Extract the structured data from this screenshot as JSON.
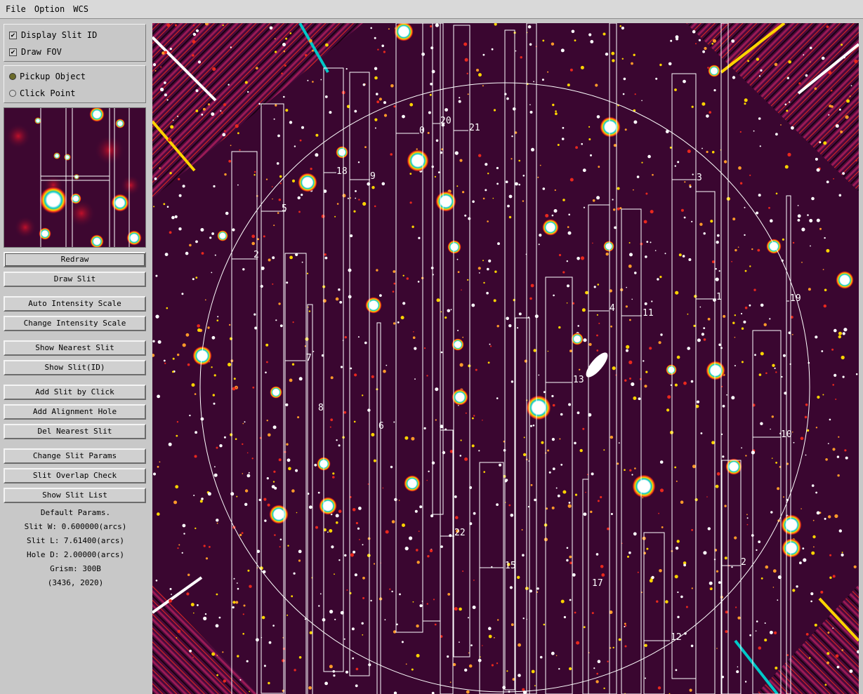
{
  "menu": {
    "file": "File",
    "option": "Option",
    "wcs": "WCS"
  },
  "display": {
    "show_slit_id": {
      "label": "Display Slit ID",
      "checked": true
    },
    "draw_fov": {
      "label": "Draw FOV",
      "checked": true
    }
  },
  "mode": {
    "pickup_object": {
      "label": "Pickup Object",
      "selected": true
    },
    "click_point": {
      "label": "Click Point",
      "selected": false
    }
  },
  "buttons": {
    "redraw": "Redraw",
    "draw_slit": "Draw Slit",
    "auto_intensity": "Auto Intensity Scale",
    "change_intensity": "Change Intensity Scale",
    "show_nearest": "Show Nearest Slit",
    "show_slit_id": "Show Slit(ID)",
    "add_slit": "Add Slit by Click",
    "add_alignment": "Add Alignment Hole",
    "del_nearest": "Del Nearest Slit",
    "change_params": "Change Slit Params",
    "overlap_check": "Slit Overlap Check",
    "show_list": "Show Slit List"
  },
  "params": {
    "heading": "Default Params.",
    "slit_w": "Slit W: 0.600000(arcs)",
    "slit_l": "Slit L: 7.61400(arcs)",
    "hole_d": "Hole D: 2.00000(arcs)",
    "grism": "Grism: 300B",
    "cursor": "(3436, 2020)"
  },
  "colors": {
    "background": "#2a0420",
    "slit_outline": "#ffffff",
    "fov_circle": "#ffffff",
    "star_core": "#ffffff",
    "star_halo": "#ffd400",
    "star_ring": "#00c8c8"
  },
  "slit_ids": [
    "1",
    "2",
    "3",
    "4",
    "5",
    "6",
    "7",
    "8",
    "9",
    "10",
    "11",
    "12",
    "13",
    "15",
    "17",
    "19",
    "20",
    "21",
    "22"
  ]
}
